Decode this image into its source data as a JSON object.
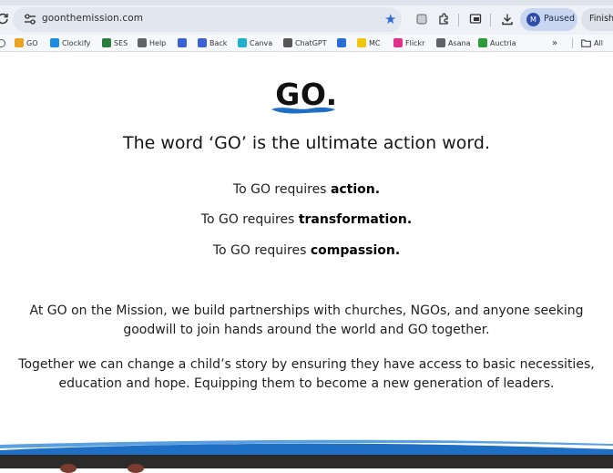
{
  "browser": {
    "url": "goonthemission.com",
    "paused_label": "Paused",
    "avatar_initial": "M",
    "finish_label": "Finish",
    "all_bookmarks_label": "All",
    "more_label": "»",
    "bookmarks": [
      {
        "label": "GO",
        "color": "#e8a321"
      },
      {
        "label": "Clockify",
        "color": "#1b8ce0"
      },
      {
        "label": "SES",
        "color": "#2a7d3a"
      },
      {
        "label": "Help",
        "color": "#5f6368"
      },
      {
        "label": "",
        "color": "#3a62d6"
      },
      {
        "label": "Back",
        "color": "#3a62d6"
      },
      {
        "label": "Canva",
        "color": "#1fb2c8"
      },
      {
        "label": "ChatGPT",
        "color": "#555555"
      },
      {
        "label": "",
        "color": "#2b6bd8"
      },
      {
        "label": "MC",
        "color": "#f1c40f"
      },
      {
        "label": "Flickr",
        "color": "#e0318a"
      },
      {
        "label": "Asana",
        "color": "#5f6368"
      },
      {
        "label": "Auctria",
        "color": "#2a9d3a"
      }
    ]
  },
  "page": {
    "logo": "GO.",
    "headline": "The word ‘GO’ is the ultimate action word.",
    "requires": [
      {
        "prefix": "To GO requires ",
        "bold": "action."
      },
      {
        "prefix": "To GO requires ",
        "bold": "transformation."
      },
      {
        "prefix": "To GO requires ",
        "bold": "compassion."
      }
    ],
    "paragraph1": "At GO on the Mission, we build partnerships with churches, NGOs, and anyone seeking goodwill to join hands around the world and GO together.",
    "paragraph2": "Together we can change a child’s story by ensuring they have access to basic necessities, education and hope. Equipping them to become a new generation of leaders."
  },
  "colors": {
    "accent_blue": "#1f6fc4",
    "bookmark_star": "#3168d8"
  }
}
